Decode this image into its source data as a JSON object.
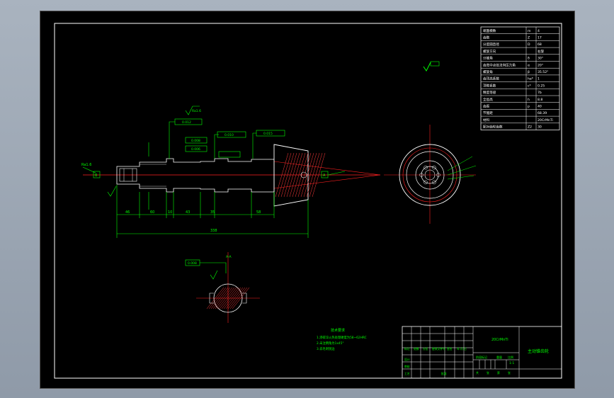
{
  "params_table": {
    "rows": [
      {
        "name": "端面模数",
        "sym": "m",
        "val": "4"
      },
      {
        "name": "齿数",
        "sym": "Z",
        "val": "17"
      },
      {
        "name": "分度圆直径",
        "sym": "D",
        "val": "68"
      },
      {
        "name": "螺旋方向",
        "sym": "",
        "val": "右旋"
      },
      {
        "name": "分锥角",
        "sym": "δ",
        "val": "30°"
      },
      {
        "name": "齿宽中点处法向压力角",
        "sym": "α",
        "val": "20°"
      },
      {
        "name": "螺旋角",
        "sym": "β",
        "val": "35.52°"
      },
      {
        "name": "齿顶高系数",
        "sym": "ha*",
        "val": "1"
      },
      {
        "name": "顶隙系数",
        "sym": "c*",
        "val": "0.25"
      },
      {
        "name": "精度等级",
        "sym": "",
        "val": "7b"
      },
      {
        "name": "全齿高",
        "sym": "h",
        "val": "8.8"
      },
      {
        "name": "齿距",
        "sym": "p",
        "val": "40"
      },
      {
        "name": "节锥距",
        "sym": "",
        "val": "68.39"
      },
      {
        "name": "材料",
        "sym": "",
        "val": "20CrMnTi"
      },
      {
        "name": "配对齿轮齿数",
        "sym": "Z2",
        "val": "30"
      }
    ]
  },
  "tech_notes": {
    "title": "技术要求",
    "lines": [
      "1.渗碳淬火热处理硬度为58~62HRC",
      "2.未注倒角为1x45°",
      "3.去毛刺锐边"
    ]
  },
  "dimensions": {
    "overall_length": "338",
    "seg1": "46",
    "seg2": "60",
    "seg3": "10",
    "seg4": "43",
    "seg5": "35",
    "seg6": "58",
    "angle_left": "Ra1.6",
    "ref_a": "A",
    "ref_b": "B"
  },
  "tolerances": {
    "t1": "0.012",
    "t2": "0.008",
    "t3": "0.006",
    "t4": "0.010",
    "t5": "0.015",
    "runout_label": "Ra1.6"
  },
  "section_view": {
    "label": "A-A",
    "tol": "0.008"
  },
  "title_block": {
    "drawing_name": "主动锥齿轮",
    "scale": "1:1",
    "material": "20CrMnTi",
    "labels": [
      "标记",
      "处数",
      "分区",
      "更改文件号",
      "签名",
      "年.月.日"
    ],
    "role_labels": [
      "设计",
      "审核",
      "工艺",
      "批准"
    ],
    "stage_label": "阶段标记",
    "weight_label": "重量",
    "scale_label": "比例",
    "sheet_labels": [
      "共",
      "张",
      "第",
      "张"
    ]
  },
  "colors": {
    "background": "#000000",
    "frame": "#ffffff",
    "part_outline": "#ffffff",
    "hatch": "#ff3b3b",
    "dimension": "#00ff00",
    "centerline": "#ff2020",
    "tolerance_box": "#00ff00"
  }
}
